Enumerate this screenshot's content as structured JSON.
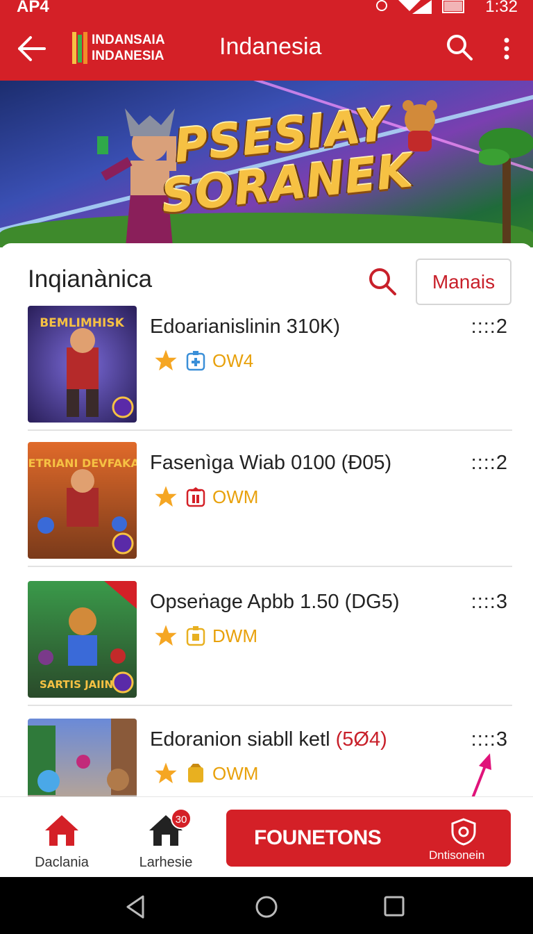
{
  "status_bar": {
    "carrier": "AP4",
    "time": "1:32"
  },
  "app_bar": {
    "brand_line1": "INDANSAIA",
    "brand_line2": "INDANESIA",
    "title": "Indanesia",
    "icons": [
      "back-arrow-icon",
      "search-icon",
      "more-vert-icon"
    ]
  },
  "banner": {
    "title_line1": "PSESIAY",
    "title_line2": "SORANEK"
  },
  "section": {
    "title": "Inqianànica",
    "filter_button": "Manais"
  },
  "list": [
    {
      "name": "Edoarianislinin 310K)",
      "paren": "",
      "tag": "OW4",
      "count": "::::2",
      "tag_icon_color": "#3a8fd8",
      "thumb_title": "BEMLIMHISK"
    },
    {
      "name": "Fasenìga Wiab 0100 ",
      "paren": "(Ð05)",
      "tag": "OWM",
      "count": "::::2",
      "tag_icon_color": "#d42027",
      "thumb_title": "ENJETRIANI DEVFAKANS"
    },
    {
      "name": "Opseṅage Apbb 1.50 ",
      "paren": "(DG5)",
      "tag": "DWM",
      "count": "::::3",
      "tag_icon_color": "#e8b020",
      "thumb_title": "SARTIS JAIIN"
    },
    {
      "name": "Edoranion siabll ketl ",
      "paren": "(5Ø4)",
      "tag": "OWM",
      "count": "::::3",
      "tag_icon_color": "#e8b020",
      "thumb_title": ""
    }
  ],
  "bottom_nav": {
    "item1": "Daclania",
    "item2": "Larhesie",
    "badge": "30",
    "cta_label": "FOUNETONS",
    "cta_sub": "Dntisonein"
  },
  "colors": {
    "primary": "#d42027",
    "tag": "#e8a10c",
    "star": "#f5a623"
  }
}
